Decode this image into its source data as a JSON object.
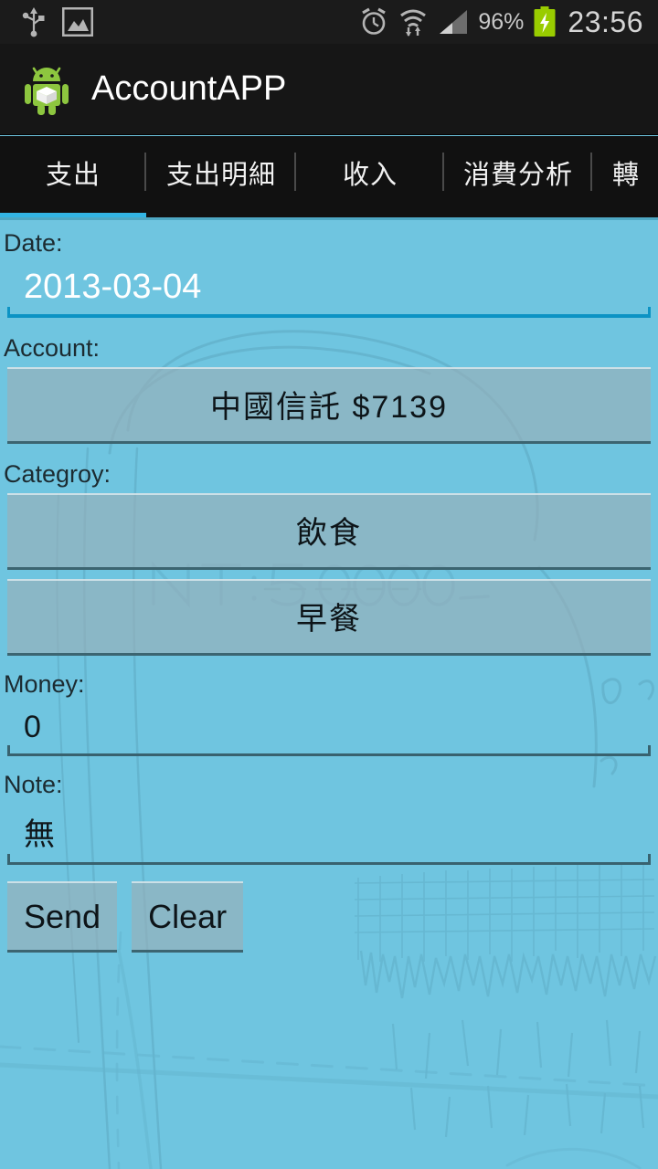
{
  "status_bar": {
    "icons_left": [
      "usb-icon",
      "screenshot-image-icon"
    ],
    "icons_right": [
      "alarm-clock-icon",
      "wifi-icon",
      "signal-bars-icon",
      "battery-charging-icon"
    ],
    "battery_percent": "96%",
    "time": "23:56"
  },
  "action_bar": {
    "icon": "android-robot-icon",
    "title": "AccountAPP"
  },
  "tabs": {
    "active_index": 0,
    "items": [
      {
        "label": "支出"
      },
      {
        "label": "支出明細"
      },
      {
        "label": "收入"
      },
      {
        "label": "消費分析"
      },
      {
        "label": "轉"
      }
    ]
  },
  "form": {
    "date": {
      "label": "Date:",
      "value": "2013-03-04",
      "focused": true
    },
    "account": {
      "label": "Account:",
      "button_value": "中國信託  $7139"
    },
    "category": {
      "label": "Categroy:",
      "button_value": "飲食",
      "subcategory_value": "早餐"
    },
    "money": {
      "label": "Money:",
      "value": "0",
      "focused": false
    },
    "note": {
      "label": "Note:",
      "value": "無",
      "focused": false
    },
    "actions": {
      "send_label": "Send",
      "clear_label": "Clear"
    }
  },
  "colors": {
    "background": "#6fc5e0",
    "accent": "#33b5e5",
    "status_bar": "#1b1b1b",
    "action_bar": "#161616",
    "tab_bar": "#111111",
    "focused_underline": "#0c93c4",
    "normal_underline": "#38626f",
    "battery_green": "#99cc00"
  }
}
